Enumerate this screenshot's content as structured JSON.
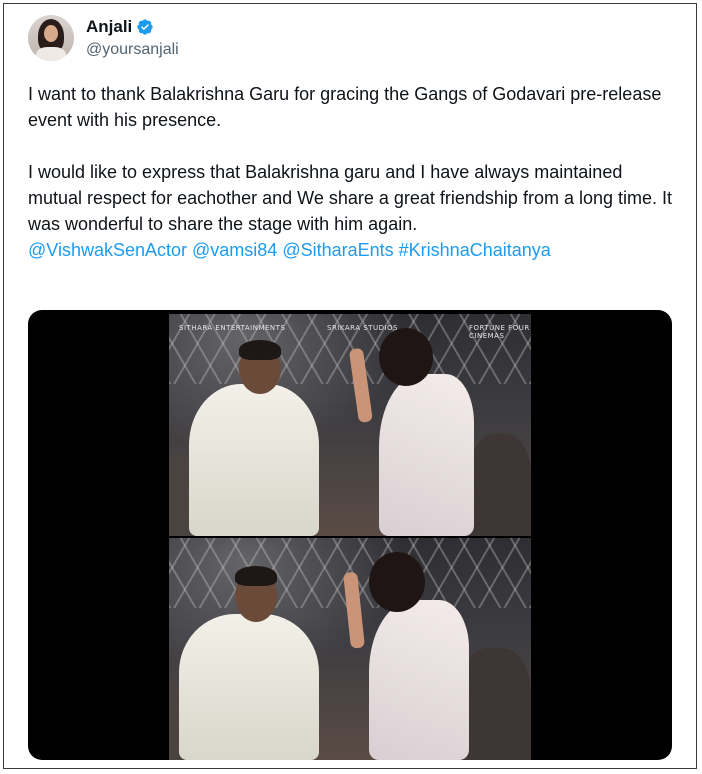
{
  "user": {
    "display_name": "Anjali",
    "handle": "@yoursanjali",
    "verified": true,
    "verified_color": "#1d9bf0"
  },
  "tweet": {
    "paragraph1": "I want to thank Balakrishna Garu for gracing the Gangs of Godavari pre-release event with his presence.",
    "paragraph2": "I would like to express that Balakrishna garu and I have always maintained mutual respect for eachother and We share a great friendship from a long time. It was wonderful to share the stage with him again.",
    "mentions": [
      "@VishwakSenActor",
      "@vamsi84",
      "@SitharaEnts",
      "#KrishnaChaitanya"
    ]
  },
  "media": {
    "logos": [
      "SITHARA ENTERTAINMENTS",
      "SRIKARA STUDIOS",
      "FORTUNE FOUR CINEMAS"
    ]
  },
  "colors": {
    "link": "#1d9bf0",
    "secondary_text": "#536471",
    "media_background": "#000000"
  }
}
